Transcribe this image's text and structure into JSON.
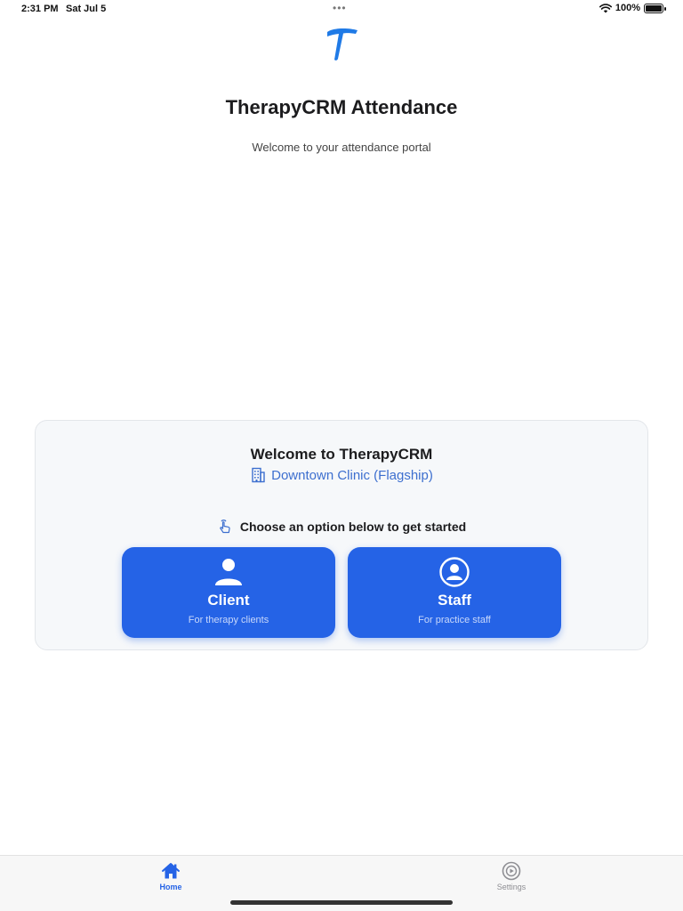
{
  "status_bar": {
    "time": "2:31 PM",
    "date": "Sat Jul 5",
    "battery": "100%"
  },
  "header": {
    "logo_icon": "therapycrm-t-logo-icon",
    "title": "TherapyCRM Attendance",
    "subtitle": "Welcome to your attendance portal"
  },
  "card": {
    "title": "Welcome to TherapyCRM",
    "clinic_icon": "building-icon",
    "clinic_name": "Downtown Clinic (Flagship)",
    "prompt_icon": "hand-tap-icon",
    "prompt": "Choose an option below to get started",
    "options": [
      {
        "icon": "person-icon",
        "label": "Client",
        "sub": "For therapy clients"
      },
      {
        "icon": "person-circle-icon",
        "label": "Staff",
        "sub": "For practice staff"
      }
    ]
  },
  "tab_bar": {
    "items": [
      {
        "icon": "house-icon",
        "label": "Home",
        "active": true
      },
      {
        "icon": "settings-play-icon",
        "label": "Settings",
        "active": false
      }
    ]
  },
  "colors": {
    "accent": "#2563e6",
    "clinic_text": "#3d6fcf",
    "card_bg": "#f6f8fa"
  }
}
